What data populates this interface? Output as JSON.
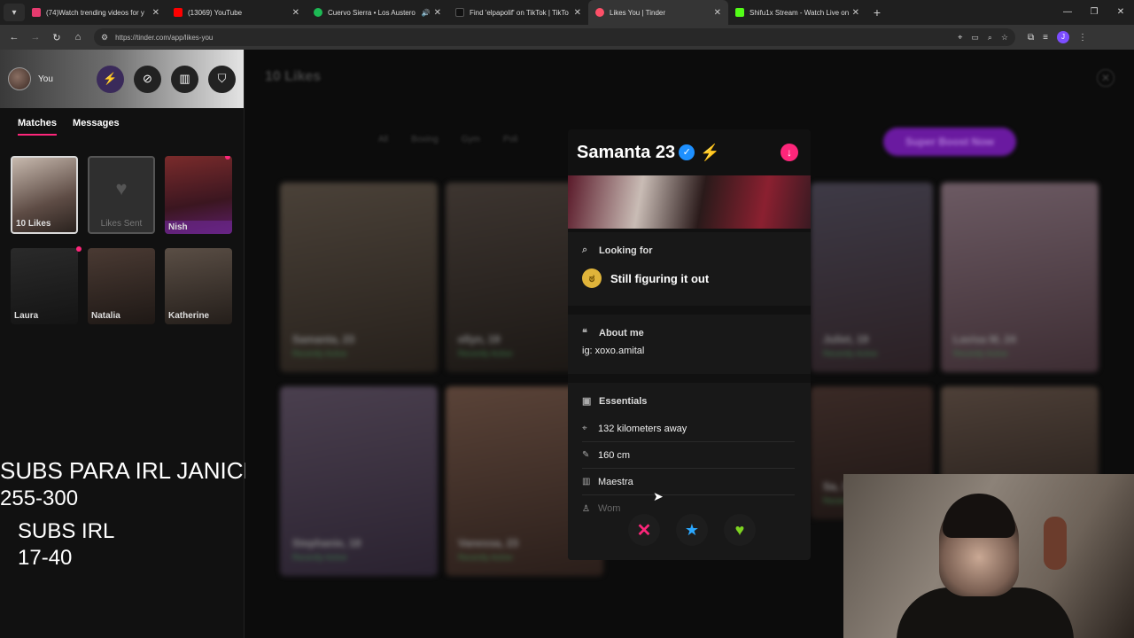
{
  "browser": {
    "tabs": [
      {
        "title": "(74)Watch trending videos for y",
        "fav_color": "#e63b6f",
        "active": false,
        "audio": false
      },
      {
        "title": "(13069) YouTube",
        "fav_color": "#ff0000",
        "active": false,
        "audio": false
      },
      {
        "title": "Cuervo Sierra • Los Austero",
        "fav_color": "#1db954",
        "active": false,
        "audio": true
      },
      {
        "title": "Find 'elpapolif' on TikTok | TikTo",
        "fav_color": "#111111",
        "active": false,
        "audio": false
      },
      {
        "title": "Likes You | Tinder",
        "fav_color": "#fd5068",
        "active": true,
        "audio": false
      },
      {
        "title": "Shifu1x Stream - Watch Live on",
        "fav_color": "#53fc18",
        "active": false,
        "audio": false
      }
    ],
    "url": "https://tinder.com/app/likes-you",
    "profile_initial": "J"
  },
  "sidebar": {
    "user_label": "You",
    "tabs": {
      "matches": "Matches",
      "messages": "Messages"
    },
    "matches": {
      "likes": "10 Likes",
      "likes_sent": "Likes Sent",
      "m1": "Nish",
      "m2": "Laura",
      "m3": "Natalia",
      "m4": "Katherine"
    }
  },
  "overlay": {
    "line1": "SUBS PARA IRL JANICE",
    "line2": "255-300",
    "line3": "SUBS IRL",
    "line4": "17-40"
  },
  "main": {
    "title": "10 Likes",
    "filters": [
      "All",
      "Boxing",
      "Gym",
      "Poli"
    ],
    "superboost": "Super Boost Now",
    "cards": [
      {
        "name": "Samanta, 23",
        "status": "Recently Active"
      },
      {
        "name": "ellyn, 19",
        "status": "Recently Active"
      },
      {
        "name": "Juliet, 19",
        "status": "Recently Active"
      },
      {
        "name": "Lavisa M, 24",
        "status": "Recently Active"
      },
      {
        "name": "Stephanie, 18",
        "status": "Recently Active"
      },
      {
        "name": "Vanessa, 23",
        "status": "Recently Active"
      },
      {
        "name": "Sa, 18",
        "status": "Recently Active"
      }
    ]
  },
  "profile": {
    "name": "Samanta 23",
    "looking_for_label": "Looking for",
    "looking_for_value": "Still figuring it out",
    "about_label": "About me",
    "about_value": "ig: xoxo.amital",
    "essentials_label": "Essentials",
    "distance": "132 kilometers away",
    "height": "160 cm",
    "job": "Maestra",
    "gender": "Wom"
  },
  "colors": {
    "accent": "#fd267a",
    "boost": "#9b4dff",
    "like": "#7dd321",
    "star": "#2ba8ff"
  }
}
